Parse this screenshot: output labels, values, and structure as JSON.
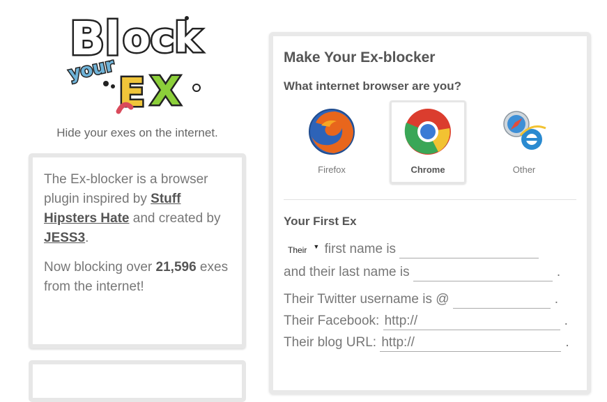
{
  "logo": {
    "text": "Block your EX"
  },
  "tagline": "Hide your exes on the internet.",
  "info": {
    "desc_prefix": "The Ex-blocker is a browser plugin inspired by ",
    "link_stuff": "Stuff Hipsters Hate",
    "desc_middle": " and created by ",
    "link_jess3": "JESS3",
    "desc_suffix": ".",
    "count_prefix": "Now blocking over ",
    "count_value": "21,596",
    "count_suffix": " exes from the internet!"
  },
  "panel": {
    "title": "Make Your Ex-blocker",
    "browser_question": "What internet browser are you?",
    "browsers": [
      {
        "label": "Firefox",
        "icon": "firefox-icon",
        "selected": false
      },
      {
        "label": "Chrome",
        "icon": "chrome-icon",
        "selected": true
      },
      {
        "label": "Other",
        "icon": "safari-ie-icon",
        "selected": false
      }
    ],
    "first_ex_title": "Your First Ex",
    "pronoun": "Their",
    "first_name_label": "first name is",
    "last_name_label": "and their last name is",
    "twitter_label": "Their Twitter username is @",
    "facebook_label": "Their Facebook:",
    "facebook_value": "http://",
    "blog_label": "Their blog URL:",
    "blog_value": "http://",
    "period": "."
  },
  "colors": {
    "box_border": "#e7e7e7",
    "text": "#777777",
    "link": "#555555"
  }
}
